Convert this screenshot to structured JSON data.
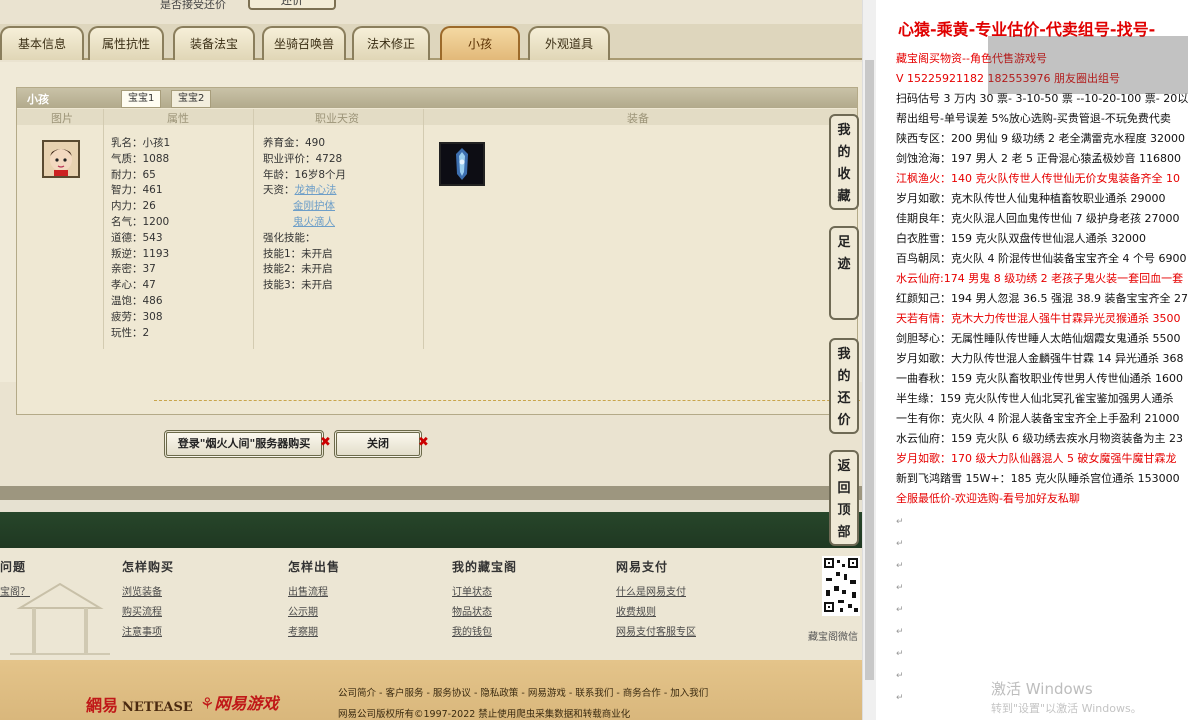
{
  "game": {
    "top_cut_text": "是否接受还价",
    "top_cut_button": "还价",
    "tabs": [
      "基本信息",
      "属性抗性",
      "装备法宝",
      "坐骑召唤兽",
      "法术修正",
      "小孩",
      "外观道具"
    ],
    "active_tab": "小孩",
    "panel_title": "小孩",
    "subtabs": [
      "宝宝1",
      "宝宝2"
    ],
    "columns": [
      "图片",
      "属性",
      "职业天资",
      "装备"
    ],
    "attributes": [
      "乳名：小孩1",
      "气质：1088",
      "耐力：65",
      "智力：461",
      "内力：26",
      "名气：1200",
      "道德：543",
      "叛逆：1193",
      "亲密：37",
      "孝心：47",
      "温饱：486",
      "疲劳：308",
      "玩性：2"
    ],
    "career": {
      "lines": [
        "养育金：490",
        "职业评价：4728",
        "年龄：16岁8个月"
      ],
      "talent_label": "天资：",
      "talents": [
        "龙神心法",
        "金刚护体",
        "鬼火滴人"
      ],
      "skill_title": "强化技能：",
      "skills": [
        "技能1：未开启",
        "技能2：未开启",
        "技能3：未开启"
      ]
    },
    "buy_button": "登录\"烟火人间\"服务器购买",
    "close_button": "关闭",
    "side_buttons": [
      "我的收藏",
      "足迹",
      "我的还价",
      "返回顶部"
    ],
    "footer": {
      "columns": [
        {
          "title": "问题",
          "links": [
            "宝阁？"
          ]
        },
        {
          "title": "怎样购买",
          "links": [
            "浏览装备",
            "购买流程",
            "注意事项"
          ]
        },
        {
          "title": "怎样出售",
          "links": [
            "出售流程",
            "公示期",
            "考察期"
          ]
        },
        {
          "title": "我的藏宝阁",
          "links": [
            "订单状态",
            "物品状态",
            "我的钱包"
          ]
        },
        {
          "title": "网易支付",
          "links": [
            "什么是网易支付",
            "收费规则",
            "网易支付客服专区"
          ]
        }
      ],
      "qr_label": "藏宝阁微信",
      "brand_cn": "網易",
      "brand_en": "NETEASE",
      "brand_games": "网易游戏",
      "links_line": "公司简介 - 客户服务 - 服务协议 - 隐私政策 - 网易游戏 - 联系我们 - 商务合作 - 加入我们",
      "copyright": "网易公司版权所有©1997-2022  禁止使用爬虫采集数据和转载商业化"
    }
  },
  "doc": {
    "title": "心猿-乘黄-专业估价-代卖组号-找号-",
    "lines": [
      {
        "text": "藏宝阁买物资--角色代售游戏号",
        "style": "red"
      },
      {
        "text": "V 15225921182 182553976 朋友圈出组号",
        "style": "red"
      },
      {
        "text": "扫码估号 3 万内 30 票- 3-10-50 票  --10-20-100 票- 20以上 1",
        "style": "black"
      },
      {
        "text": "帮出组号-单号误差 5%放心选购-买贵管退-不玩免费代卖",
        "style": "black"
      },
      {
        "text": "陕西专区：200 男仙 9 级功绣 2 老全满雷克水程度 32000",
        "style": "black"
      },
      {
        "text": "剑蚀沧海：197 男人 2 老 5 正骨混心猿孟极妙音 116800",
        "style": "black"
      },
      {
        "text": "江枫渔火：140 克火队传世人传世仙无价女鬼装备齐全 10",
        "style": "red"
      },
      {
        "text": "岁月如歌：克木队传世人仙鬼种植畜牧职业通杀 29000",
        "style": "black"
      },
      {
        "text": "佳期良年：克火队混人回血鬼传世仙 7 级护身老孩 27000",
        "style": "black"
      },
      {
        "text": "白衣胜雪：159 克火队双盘传世仙混人通杀 32000",
        "style": "black"
      },
      {
        "text": "百鸟朝凤：克火队 4 阶混传世仙装备宝宝齐全 4 个号 6900",
        "style": "black"
      },
      {
        "text": "水云仙府:174 男鬼 8 级功绣 2 老孩子鬼火装一套回血一套",
        "style": "red"
      },
      {
        "text": "红颜知己：194 男人忽混 36.5 强混 38.9 装备宝宝齐全 270",
        "style": "black"
      },
      {
        "text": "天若有情：克木大力传世混人强牛甘霖异光灵猴通杀 3500",
        "style": "red"
      },
      {
        "text": "剑胆琴心：无属性睡队传世睡人太皓仙烟霞女鬼通杀 5500",
        "style": "black"
      },
      {
        "text": "岁月如歌：大力队传世混人金麟强牛甘霖 14 异光通杀 368",
        "style": "black"
      },
      {
        "text": "一曲春秋：159 克火队畜牧职业传世男人传世仙通杀 1600",
        "style": "black"
      },
      {
        "text": "半生缘：159 克火队传世人仙北冥孔雀宝鉴加强男人通杀",
        "style": "black"
      },
      {
        "text": "一生有你：克火队 4 阶混人装备宝宝齐全上手盈利 21000",
        "style": "black"
      },
      {
        "text": "水云仙府：159 克火队 6 级功绣去疾水月物资装备为主 23",
        "style": "black"
      },
      {
        "text": "岁月如歌：170 级大力队仙器混人 5 破女魔强牛魔甘霖龙",
        "style": "red"
      },
      {
        "text": "新到飞鸿踏雪 15W+：185 克火队睡杀宫位通杀 153000",
        "style": "black"
      },
      {
        "text": "全服最低价-欢迎选购-看号加好友私聊",
        "style": "red"
      }
    ],
    "watermark_1": "激活 Windows",
    "watermark_2": "转到\"设置\"以激活 Windows。"
  }
}
